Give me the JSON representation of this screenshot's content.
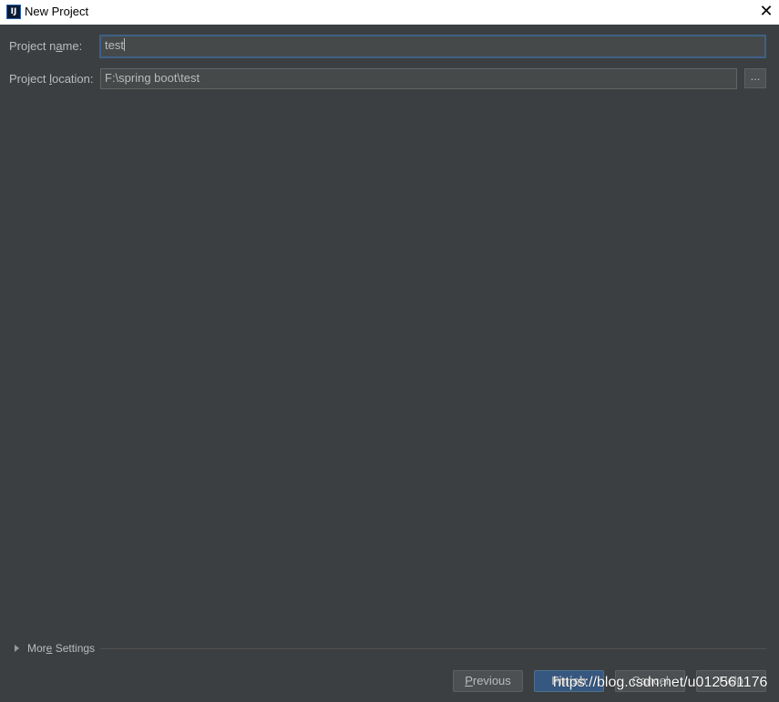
{
  "window": {
    "title": "New Project",
    "close_glyph": "✕"
  },
  "form": {
    "name_label_pre": "Project n",
    "name_label_ul": "a",
    "name_label_post": "me:",
    "name_value": "test",
    "location_label_pre": "Project ",
    "location_label_ul": "l",
    "location_label_post": "ocation:",
    "location_value": "F:\\spring boot\\test",
    "browse_label": "..."
  },
  "more_settings": {
    "label_pre": "Mor",
    "label_ul": "e",
    "label_post": " Settings"
  },
  "buttons": {
    "previous_ul": "P",
    "previous_rest": "revious",
    "finish": "Finish",
    "cancel": "Cancel",
    "help": "Help"
  },
  "watermark": "https://blog.csdn.net/u012561176",
  "icons": {
    "app": "intellij-idea-icon",
    "expand": "triangle-right-icon",
    "close": "close-icon"
  },
  "colors": {
    "background": "#3c3f41",
    "field": "#45494a",
    "accent": "#365880",
    "focus": "#3d6185"
  }
}
